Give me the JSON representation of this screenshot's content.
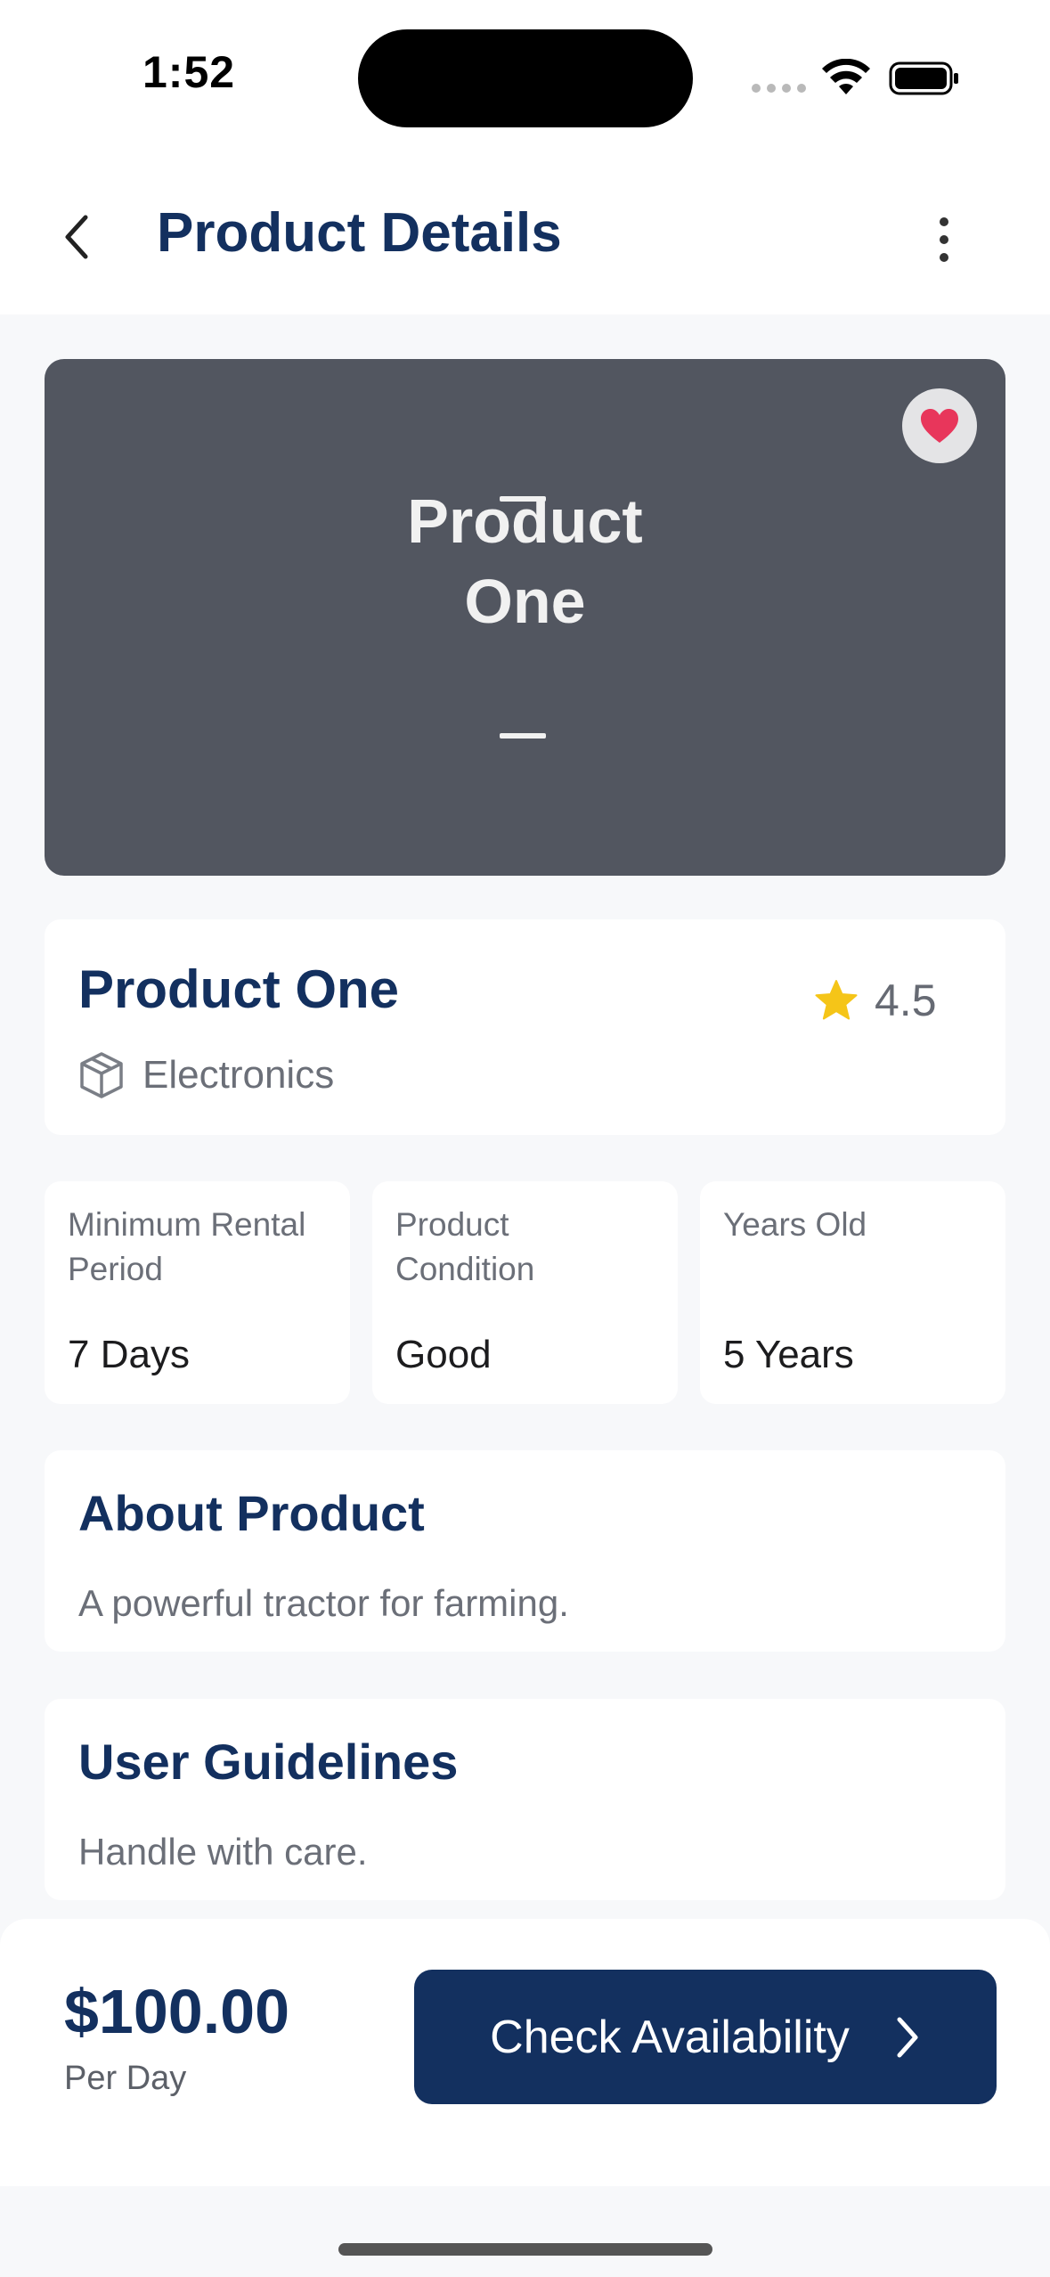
{
  "status_bar": {
    "time": "1:52"
  },
  "header": {
    "title": "Product Details"
  },
  "image": {
    "placeholder_line1": "Product",
    "placeholder_line2": "One"
  },
  "product": {
    "name": "Product One",
    "rating": "4.5",
    "category": "Electronics"
  },
  "stats": [
    {
      "label": "Minimum Rental Period",
      "value": "7 Days"
    },
    {
      "label": "Product Condition",
      "value": "Good"
    },
    {
      "label": "Years Old",
      "value": "5 Years"
    }
  ],
  "about": {
    "title": "About Product",
    "text": "A powerful tractor for farming."
  },
  "guidelines": {
    "title": "User Guidelines",
    "text": "Handle with care."
  },
  "footer": {
    "price": "$100.00",
    "price_unit": "Per Day",
    "cta_label": "Check Availability"
  },
  "colors": {
    "primary": "#13305f",
    "favorite": "#e8365b",
    "star": "#f5c518",
    "image_bg": "#525660"
  },
  "icons": {
    "back": "chevron-left-icon",
    "more": "more-vertical-icon",
    "favorite": "heart-icon",
    "rating": "star-icon",
    "category": "box-icon",
    "cta": "chevron-right-icon"
  }
}
